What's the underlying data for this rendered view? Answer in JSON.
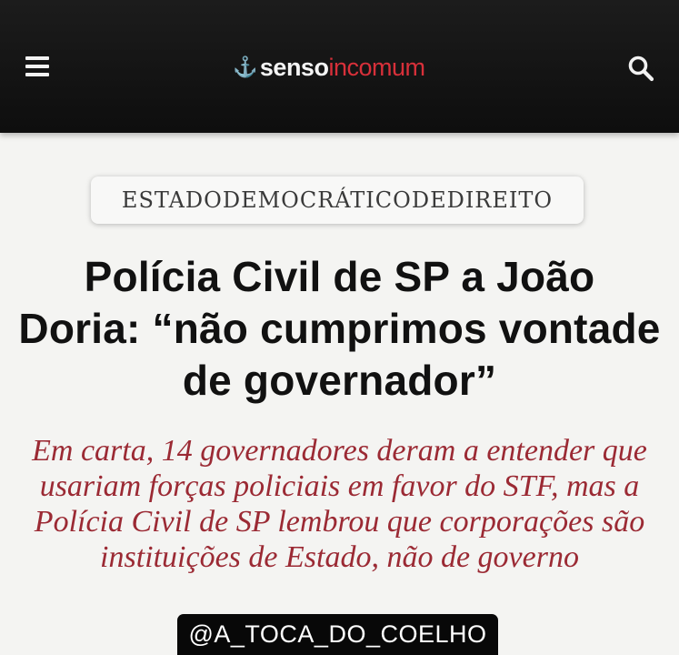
{
  "header": {
    "menu_icon": "hamburger-menu-icon",
    "logo": {
      "anchor_glyph": "⚓",
      "part1": "senso",
      "part2": "incomum",
      "part2_color": "#d8303a"
    },
    "search_icon": "search-icon",
    "background_color": "#141414"
  },
  "article": {
    "category": "ESTADODEMOCRÁTICODEDIREITO",
    "headline": "Polícia Civil de SP a João Doria: “não cumprimos vontade de governador”",
    "subtitle": "Em carta, 14 governadores deram a entender que usariam forças policiais em favor do STF, mas a Polícia Civil de SP lembrou que corporações são instituições de Estado, não de governo",
    "subtitle_color": "#9b2a34"
  },
  "watermark": {
    "text": "@A_TOCA_DO_COELHO"
  }
}
